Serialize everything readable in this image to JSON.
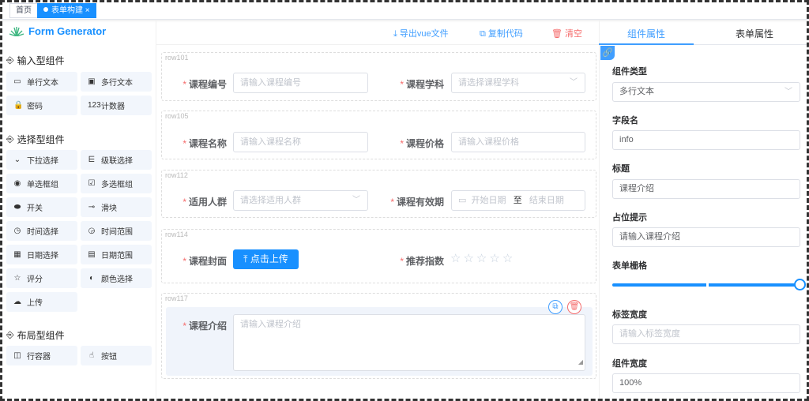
{
  "tabs": [
    {
      "label": "首页"
    },
    {
      "label": "表单构建",
      "close": "×"
    }
  ],
  "logo": "Form Generator",
  "left": {
    "groups": [
      {
        "title": "输入型组件",
        "items": [
          {
            "label": "单行文本",
            "icon": "▭"
          },
          {
            "label": "多行文本",
            "icon": "▣"
          },
          {
            "label": "密码",
            "icon": "🔒"
          },
          {
            "label": "计数器",
            "icon": "123"
          }
        ]
      },
      {
        "title": "选择型组件",
        "items": [
          {
            "label": "下拉选择",
            "icon": "⌄"
          },
          {
            "label": "级联选择",
            "icon": "⋿"
          },
          {
            "label": "单选框组",
            "icon": "◉"
          },
          {
            "label": "多选框组",
            "icon": "☑"
          },
          {
            "label": "开关",
            "icon": "⬬"
          },
          {
            "label": "滑块",
            "icon": "⊸"
          },
          {
            "label": "时间选择",
            "icon": "◷"
          },
          {
            "label": "时间范围",
            "icon": "◶"
          },
          {
            "label": "日期选择",
            "icon": "▦"
          },
          {
            "label": "日期范围",
            "icon": "▤"
          },
          {
            "label": "评分",
            "icon": "☆"
          },
          {
            "label": "颜色选择",
            "icon": "◐"
          },
          {
            "label": "上传",
            "icon": "☁"
          }
        ]
      },
      {
        "title": "布局型组件",
        "items": [
          {
            "label": "行容器",
            "icon": "◫"
          },
          {
            "label": "按钮",
            "icon": "☝"
          }
        ]
      }
    ]
  },
  "toolbar": {
    "export": "导出vue文件",
    "copy": "复制代码",
    "clear": "清空"
  },
  "rows": [
    {
      "tag": "row101",
      "f1": {
        "label": "课程编号",
        "placeholder": "请输入课程编号"
      },
      "f2": {
        "label": "课程学科",
        "placeholder": "请选择课程学科"
      }
    },
    {
      "tag": "row105",
      "f1": {
        "label": "课程名称",
        "placeholder": "请输入课程名称"
      },
      "f2": {
        "label": "课程价格",
        "placeholder": "请输入课程价格"
      }
    },
    {
      "tag": "row112",
      "f1": {
        "label": "适用人群",
        "placeholder": "请选择适用人群"
      },
      "f2": {
        "label": "课程有效期",
        "start": "开始日期",
        "sep": "至",
        "end": "结束日期"
      }
    },
    {
      "tag": "row114",
      "f1": {
        "label": "课程封面",
        "button": "点击上传"
      },
      "f2": {
        "label": "推荐指数",
        "stars": 5,
        "value": 0
      }
    },
    {
      "tag": "row117",
      "f1": {
        "label": "课程介绍",
        "placeholder": "请输入课程介绍"
      }
    }
  ],
  "right": {
    "tabs": [
      "组件属性",
      "表单属性"
    ],
    "fields": {
      "type_label": "组件类型",
      "type_value": "多行文本",
      "field_label": "字段名",
      "field_value": "info",
      "title_label": "标题",
      "title_value": "课程介绍",
      "ph_label": "占位提示",
      "ph_value": "请输入课程介绍",
      "span_label": "表单栅格",
      "span_value": 24,
      "span_max": 24,
      "lw_label": "标签宽度",
      "lw_placeholder": "请输入标签宽度",
      "cw_label": "组件宽度",
      "cw_value": "100%"
    }
  },
  "colors": {
    "primary": "#1890ff",
    "danger": "#f56c6c"
  }
}
